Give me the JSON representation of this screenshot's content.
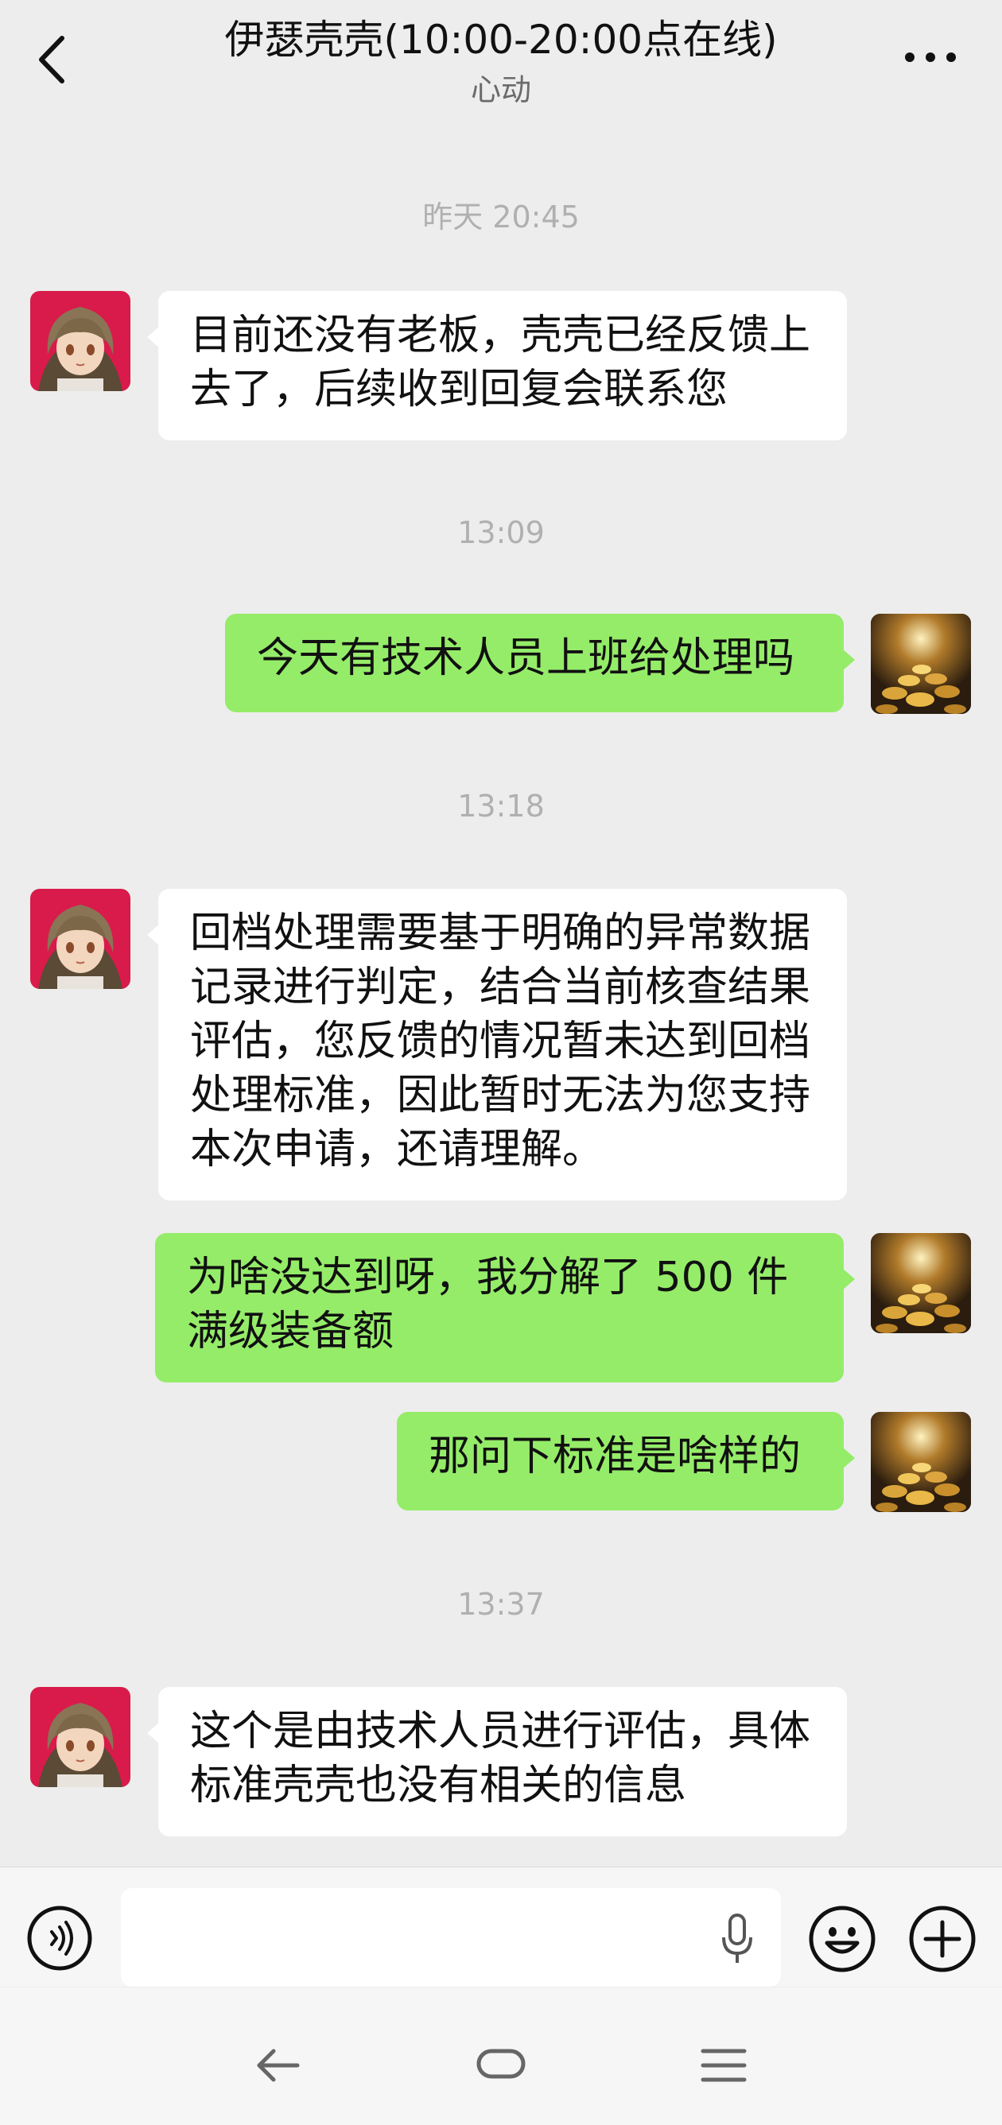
{
  "header": {
    "title": "伊瑟壳壳(10:00-20:00点在线)",
    "subtitle": "心动"
  },
  "messages": [
    {
      "type": "time",
      "text": "昨天 20:45"
    },
    {
      "type": "msg",
      "side": "left",
      "text": "目前还没有老板，壳壳已经反馈上\n去了，后续收到回复会联系您"
    },
    {
      "type": "time",
      "text": "13:09"
    },
    {
      "type": "msg",
      "side": "right",
      "text": "今天有技术人员上班给处理吗"
    },
    {
      "type": "time",
      "text": "13:18"
    },
    {
      "type": "msg",
      "side": "left",
      "text": "回档处理需要基于明确的异常数据\n记录进行判定，结合当前核查结果\n评估，您反馈的情况暂未达到回档\n处理标准，因此暂时无法为您支持\n本次申请，还请理解。"
    },
    {
      "type": "msg",
      "side": "right",
      "text": "为啥没达到呀，我分解了 500 件\n满级装备额"
    },
    {
      "type": "msg",
      "side": "right",
      "text": "那问下标准是啥样的"
    },
    {
      "type": "time",
      "text": "13:37"
    },
    {
      "type": "msg",
      "side": "left",
      "text": "这个是由技术人员进行评估，具体\n标准壳壳也没有相关的信息"
    }
  ],
  "colors": {
    "background": "#ededed",
    "bubble_self": "#95ec69",
    "bubble_other": "#ffffff"
  },
  "icons": {
    "back": "chevron-left-icon",
    "more": "more-dots-icon",
    "voice": "voice-icon",
    "mic": "microphone-icon",
    "emoji": "emoji-icon",
    "plus": "plus-icon"
  }
}
